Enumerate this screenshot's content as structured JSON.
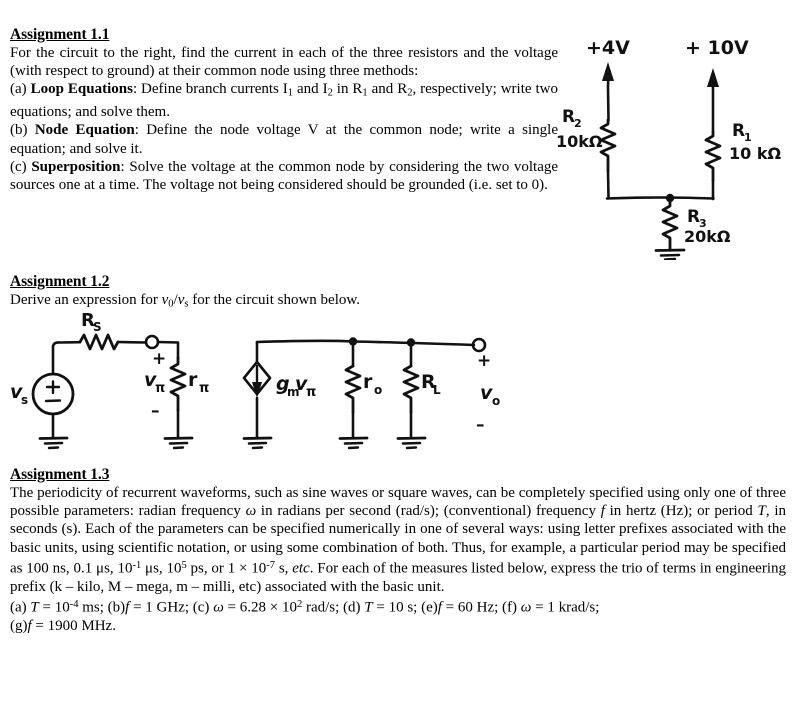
{
  "document": {
    "type": "homework-assignment-sheet",
    "background_color": "#ffffff",
    "ink_color": "#111111"
  },
  "assignment_1_1": {
    "heading": "Assignment 1.1",
    "intro": "For the circuit to the right, find the current in each of the three resistors and the voltage (with respect to ground) at their common node using three methods:",
    "parts": [
      {
        "marker": "(a)",
        "title": "Loop Equations",
        "text_before_sub": ": Define branch currents I",
        "sub_1": "1",
        "text_mid_1": " and I",
        "sub_2": "2",
        "text_mid_2": " in R",
        "sub_3": "1",
        "text_mid_3": " and R",
        "sub_4": "2",
        "text_after": ", respectively; write two equations; and solve them."
      },
      {
        "marker": "(b)",
        "title": "Node Equation",
        "text": ": Define the node voltage V at the common node; write a single equation; and solve it."
      },
      {
        "marker": "(c)",
        "title": "Superposition",
        "text": ": Solve the voltage at the common node by considering the two voltage sources one at a time. The voltage not being considered should be grounded (i.e. set to 0)."
      }
    ]
  },
  "circuit_1": {
    "title": "resistor-network-circuit",
    "description": "Two voltage sources +4V and +10V feeding a common node through R2 and R1, with R3 to ground",
    "labels": {
      "source_left": "+4V",
      "source_right": "+ 10V",
      "r2_name": "R",
      "r2_sub": "2",
      "r2_value": "10kΩ",
      "r1_name": "R",
      "r1_sub": "1",
      "r1_value": "10 kΩ",
      "r3_name": "R",
      "r3_sub": "3",
      "r3_value": "20kΩ"
    }
  },
  "assignment_1_2": {
    "heading": "Assignment 1.2",
    "text_a": "Derive an expression for ",
    "var_vo": "v",
    "sub_o": "0",
    "slash": "/",
    "var_vs": "v",
    "sub_s": "s",
    "text_b": " for the circuit shown below."
  },
  "circuit_2": {
    "title": "small-signal-amplifier-model",
    "description": "Source vs with Rs driving r-pi, dependent current source gm*v-pi driving ro parallel RL producing vo",
    "labels": {
      "source_label": "v",
      "source_sub": "s",
      "rs_name": "R",
      "rs_sub": "S",
      "vpi_name": "v",
      "vpi_sub": "π",
      "rpi_name": "r",
      "rpi_sub": "π",
      "plus_sign": "+",
      "minus_sign": "–",
      "dep_source_gm": "g",
      "dep_source_gm_sub": "m",
      "dep_source_v": "v",
      "dep_source_v_sub": "π",
      "ro_name": "r",
      "ro_sub": "o",
      "rl_name": "R",
      "rl_sub": "L",
      "vo_name": "v",
      "vo_sub": "o",
      "out_plus": "+",
      "out_minus": "–"
    }
  },
  "assignment_1_3": {
    "heading": "Assignment 1.3",
    "para_seg_1": "The periodicity of recurrent waveforms, such as sine waves or square waves, can be completely specified using only one of three possible parameters: radian frequency ",
    "omega_1": "ω",
    "para_seg_2": " in radians per second (rad/s); (conventional) frequency ",
    "f_1": "f",
    "para_seg_3": " in hertz (Hz); or period ",
    "T_1": "T",
    "para_seg_4": ", in seconds (s). Each of the parameters can be specified numerically in one of several ways: using letter prefixes associated with the basic units, using scientific notation, or using some combination of both. Thus, for example, a particular period may be specified as 100 ns, 0.1 μs, 10",
    "exp_neg1": "-1",
    "para_seg_5": " μs, 10",
    "exp_5": "5",
    "para_seg_6": " ps, or 1 × 10",
    "exp_neg7": "-7",
    "para_seg_7": " s, ",
    "etc": "etc",
    "para_seg_8": ". For each of the measures listed below, express the trio of terms in engineering prefix (k – kilo, M – mega, m – milli, etc) associated with the basic unit.",
    "items_line_1": {
      "a_marker": "(a)",
      "a_var": "T",
      "a_eq": " = 10",
      "a_exp": "-4",
      "a_unit": " ms; ",
      "b_marker": "(b)",
      "b_var": "f",
      "b_val": " = 1 GHz; ",
      "c_marker": "(c)",
      "c_var": "ω",
      "c_eq": " = 6.28 × 10",
      "c_exp": "2",
      "c_unit": " rad/s; ",
      "d_marker": "(d)",
      "d_var": "T",
      "d_val": " = 10 s; ",
      "e_marker": "(e)",
      "e_var": "f",
      "e_val": " = 60 Hz; ",
      "f_marker": "(f)",
      "f_var": "ω",
      "f_val": " = 1 krad/s;"
    },
    "items_line_2": {
      "g_marker": "(g)",
      "g_var": "f",
      "g_val": " = 1900 MHz."
    }
  }
}
